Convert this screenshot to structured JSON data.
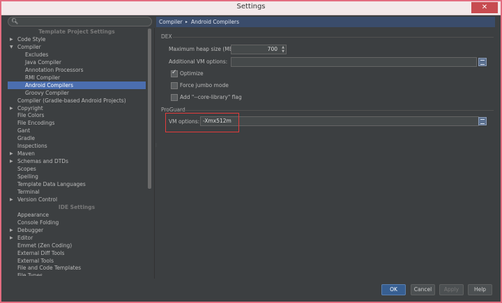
{
  "window": {
    "title": "Settings",
    "close_glyph": "✕"
  },
  "search": {
    "placeholder": "",
    "icon": "search-icon"
  },
  "sidebar": {
    "sections": {
      "project": "Template Project Settings",
      "ide": "IDE Settings"
    },
    "project_items": [
      {
        "label": "Code Style",
        "arrow": "▶",
        "indent": 0
      },
      {
        "label": "Compiler",
        "arrow": "▼",
        "indent": 0
      },
      {
        "label": "Excludes",
        "arrow": "",
        "indent": 2
      },
      {
        "label": "Java Compiler",
        "arrow": "",
        "indent": 2
      },
      {
        "label": "Annotation Processors",
        "arrow": "",
        "indent": 2
      },
      {
        "label": "RMI Compiler",
        "arrow": "",
        "indent": 2
      },
      {
        "label": "Android Compilers",
        "arrow": "",
        "indent": 2,
        "selected": true
      },
      {
        "label": "Groovy Compiler",
        "arrow": "",
        "indent": 2
      },
      {
        "label": "Compiler (Gradle-based Android Projects)",
        "arrow": "",
        "indent": 1
      },
      {
        "label": "Copyright",
        "arrow": "▶",
        "indent": 0
      },
      {
        "label": "File Colors",
        "arrow": "",
        "indent": 1
      },
      {
        "label": "File Encodings",
        "arrow": "",
        "indent": 1
      },
      {
        "label": "Gant",
        "arrow": "",
        "indent": 1
      },
      {
        "label": "Gradle",
        "arrow": "",
        "indent": 1
      },
      {
        "label": "Inspections",
        "arrow": "",
        "indent": 1
      },
      {
        "label": "Maven",
        "arrow": "▶",
        "indent": 0
      },
      {
        "label": "Schemas and DTDs",
        "arrow": "▶",
        "indent": 0
      },
      {
        "label": "Scopes",
        "arrow": "",
        "indent": 1
      },
      {
        "label": "Spelling",
        "arrow": "",
        "indent": 1
      },
      {
        "label": "Template Data Languages",
        "arrow": "",
        "indent": 1
      },
      {
        "label": "Terminal",
        "arrow": "",
        "indent": 1
      },
      {
        "label": "Version Control",
        "arrow": "▶",
        "indent": 0
      }
    ],
    "ide_items": [
      {
        "label": "Appearance",
        "arrow": "",
        "indent": 1
      },
      {
        "label": "Console Folding",
        "arrow": "",
        "indent": 1
      },
      {
        "label": "Debugger",
        "arrow": "▶",
        "indent": 0
      },
      {
        "label": "Editor",
        "arrow": "▶",
        "indent": 0
      },
      {
        "label": "Emmet (Zen Coding)",
        "arrow": "",
        "indent": 1
      },
      {
        "label": "External Diff Tools",
        "arrow": "",
        "indent": 1
      },
      {
        "label": "External Tools",
        "arrow": "",
        "indent": 1
      },
      {
        "label": "File and Code Templates",
        "arrow": "",
        "indent": 1
      },
      {
        "label": "File Types",
        "arrow": "",
        "indent": 1
      }
    ]
  },
  "breadcrumb": {
    "parent": "Compiler",
    "separator": "▸",
    "current": "Android Compilers"
  },
  "dex": {
    "title": "DEX",
    "heap_label": "Maximum heap size (MB):",
    "heap_value": "700",
    "additional_label": "Additional VM options:",
    "additional_value": "",
    "optimize_label": "Optimize",
    "optimize_checked": true,
    "force_jumbo_label": "Force jumbo mode",
    "force_jumbo_checked": false,
    "core_library_label": "Add \"--core-library\" flag",
    "core_library_checked": false
  },
  "proguard": {
    "title": "ProGuard",
    "vm_label": "VM options:",
    "vm_value": "-Xmx512m"
  },
  "buttons": {
    "ok": "OK",
    "cancel": "Cancel",
    "apply": "Apply",
    "help": "Help"
  },
  "colors": {
    "accent": "#4b6eaf",
    "highlight_box": "#e33b3b",
    "window_border": "#e36d80"
  }
}
